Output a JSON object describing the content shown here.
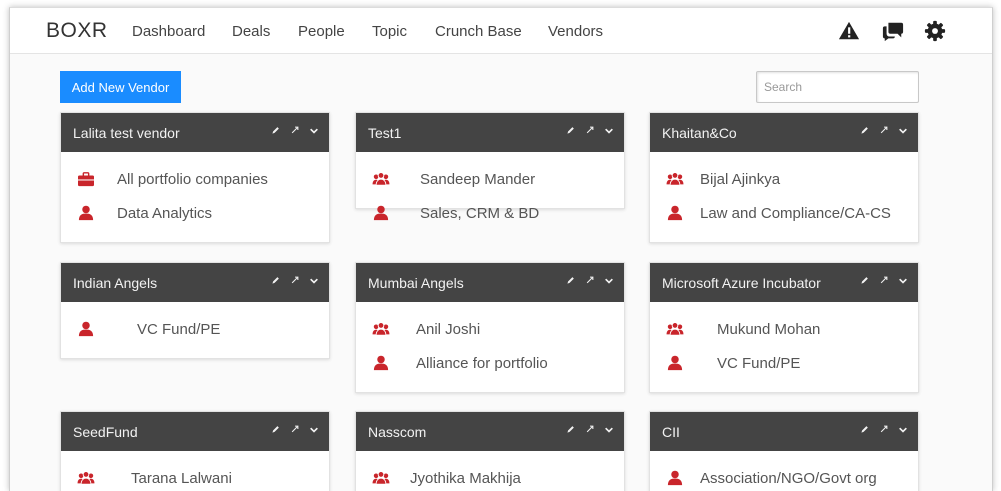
{
  "app": {
    "brand": "BOXR"
  },
  "nav": {
    "items": [
      {
        "label": "Dashboard"
      },
      {
        "label": "Deals"
      },
      {
        "label": "People"
      },
      {
        "label": "Topic"
      },
      {
        "label": "Crunch Base"
      },
      {
        "label": "Vendors"
      }
    ],
    "icons": [
      "alert-triangle-icon",
      "chat-bubbles-icon",
      "gear-icon"
    ]
  },
  "toolbar": {
    "add_vendor_label": "Add New Vendor"
  },
  "search": {
    "placeholder": "Search",
    "value": ""
  },
  "colors": {
    "accent": "#1a8cff",
    "card_header": "#444444",
    "icon_red": "#c9252b"
  },
  "vendors": [
    {
      "title": "Lalita test vendor",
      "rows": [
        {
          "icon": "briefcase-icon",
          "text": "All portfolio companies"
        },
        {
          "icon": "user-icon",
          "text": "Data Analytics"
        }
      ]
    },
    {
      "title": "Test1",
      "rows": [
        {
          "icon": "users-group-icon",
          "text": "Sandeep Mander"
        },
        {
          "icon": "user-icon",
          "text": "Sales, CRM & BD"
        }
      ]
    },
    {
      "title": "Khaitan&Co",
      "rows": [
        {
          "icon": "users-group-icon",
          "text": "Bijal Ajinkya"
        },
        {
          "icon": "user-icon",
          "text": "Law and Compliance/CA-CS"
        }
      ]
    },
    {
      "title": "Indian Angels",
      "rows": [
        {
          "icon": "user-icon",
          "text": "VC Fund/PE"
        }
      ]
    },
    {
      "title": "Mumbai Angels",
      "rows": [
        {
          "icon": "users-group-icon",
          "text": "Anil Joshi"
        },
        {
          "icon": "user-icon",
          "text": "Alliance for portfolio"
        }
      ]
    },
    {
      "title": "Microsoft Azure Incubator",
      "rows": [
        {
          "icon": "users-group-icon",
          "text": "Mukund Mohan"
        },
        {
          "icon": "user-icon",
          "text": "VC Fund/PE"
        }
      ]
    },
    {
      "title": "SeedFund",
      "rows": [
        {
          "icon": "users-group-icon",
          "text": "Tarana Lalwani"
        }
      ]
    },
    {
      "title": "Nasscom",
      "rows": [
        {
          "icon": "users-group-icon",
          "text": "Jyothika Makhija"
        }
      ]
    },
    {
      "title": "CII",
      "rows": [
        {
          "icon": "user-icon",
          "text": "Association/NGO/Govt org"
        }
      ]
    }
  ]
}
